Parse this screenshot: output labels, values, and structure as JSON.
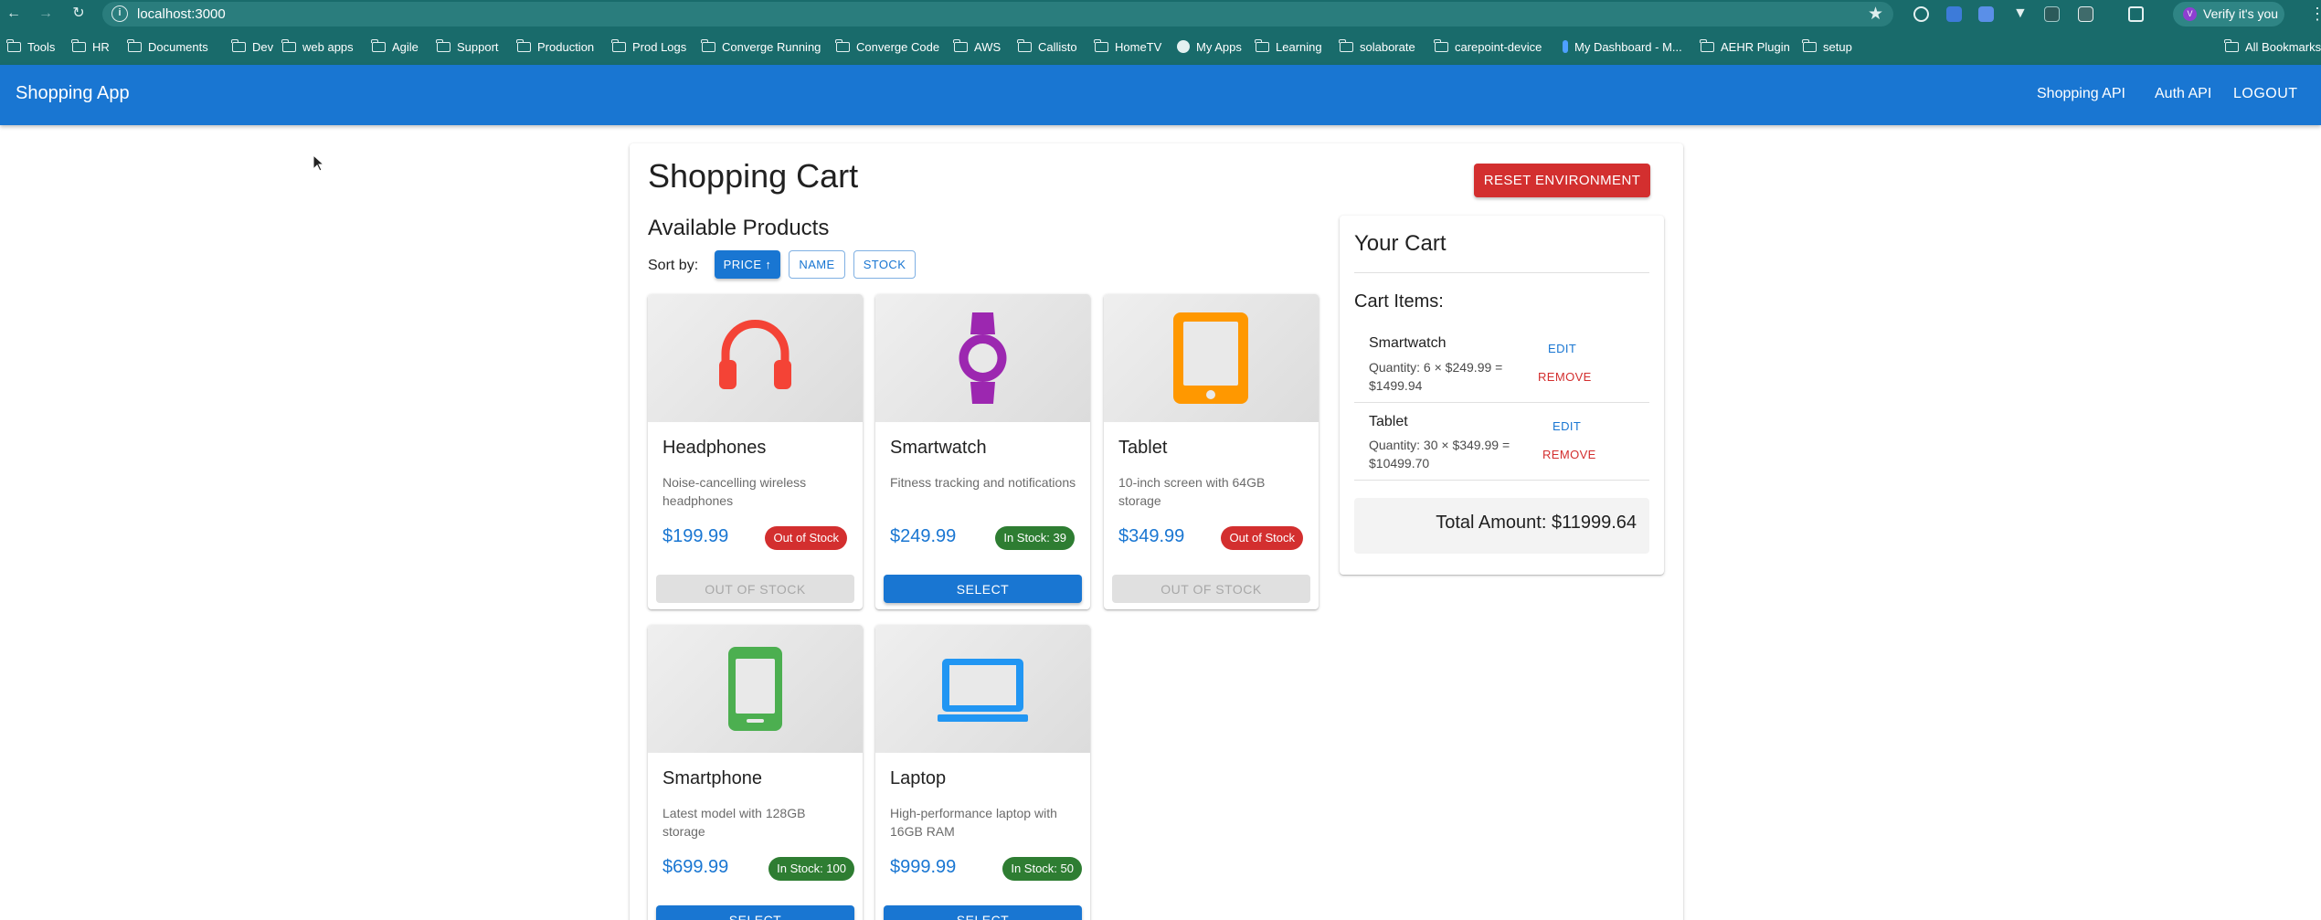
{
  "browser": {
    "url": "localhost:3000",
    "profile_label": "Verify it's you",
    "profile_initial": "V",
    "all_bookmarks_label": "All Bookmarks",
    "bookmarks": [
      {
        "label": "Tools",
        "icon": "folder-icon"
      },
      {
        "label": "HR",
        "icon": "folder-icon"
      },
      {
        "label": "Documents",
        "icon": "folder-icon"
      },
      {
        "label": "Dev",
        "icon": "folder-icon"
      },
      {
        "label": "web apps",
        "icon": "folder-icon"
      },
      {
        "label": "Agile",
        "icon": "folder-icon"
      },
      {
        "label": "Support",
        "icon": "folder-icon"
      },
      {
        "label": "Production",
        "icon": "folder-icon"
      },
      {
        "label": "Prod Logs",
        "icon": "folder-icon"
      },
      {
        "label": "Converge Running",
        "icon": "folder-icon"
      },
      {
        "label": "Converge Code",
        "icon": "folder-icon"
      },
      {
        "label": "AWS",
        "icon": "folder-icon"
      },
      {
        "label": "Callisto",
        "icon": "folder-icon"
      },
      {
        "label": "HomeTV",
        "icon": "folder-icon"
      },
      {
        "label": "My Apps",
        "icon": "globe-icon"
      },
      {
        "label": "Learning",
        "icon": "folder-icon"
      },
      {
        "label": "solaborate",
        "icon": "folder-icon"
      },
      {
        "label": "carepoint-device",
        "icon": "folder-icon"
      },
      {
        "label": "My Dashboard - M...",
        "icon": "bookmark-pin-icon"
      },
      {
        "label": "AEHR Plugin",
        "icon": "folder-icon"
      },
      {
        "label": "setup",
        "icon": "folder-icon"
      }
    ]
  },
  "app": {
    "brand": "Shopping App",
    "nav": [
      "Shopping API",
      "Auth API",
      "LOGOUT"
    ]
  },
  "page": {
    "title": "Shopping Cart",
    "reset_label": "RESET ENVIRONMENT",
    "products_heading": "Available Products",
    "sort_label": "Sort by:",
    "sort_options": [
      "PRICE ↑",
      "NAME",
      "STOCK"
    ],
    "sort_active": "PRICE ↑"
  },
  "products": [
    {
      "name": "Headphones",
      "description": "Noise-cancelling wireless headphones",
      "price": "$199.99",
      "stock_label": "Out of Stock",
      "button_label": "OUT OF STOCK",
      "in_stock": false,
      "icon": "headphones-icon",
      "icon_color": "#f44336"
    },
    {
      "name": "Smartwatch",
      "description": "Fitness tracking and notifications",
      "price": "$249.99",
      "stock_label": "In Stock: 39",
      "button_label": "SELECT",
      "in_stock": true,
      "icon": "watch-icon",
      "icon_color": "#9c27b0"
    },
    {
      "name": "Tablet",
      "description": "10-inch screen with 64GB storage",
      "price": "$349.99",
      "stock_label": "Out of Stock",
      "button_label": "OUT OF STOCK",
      "in_stock": false,
      "icon": "tablet-icon",
      "icon_color": "#ff9800"
    },
    {
      "name": "Smartphone",
      "description": "Latest model with 128GB storage",
      "price": "$699.99",
      "stock_label": "In Stock: 100",
      "button_label": "SELECT",
      "in_stock": true,
      "icon": "smartphone-icon",
      "icon_color": "#4caf50"
    },
    {
      "name": "Laptop",
      "description": "High-performance laptop with 16GB RAM",
      "price": "$999.99",
      "stock_label": "In Stock: 50",
      "button_label": "SELECT",
      "in_stock": true,
      "icon": "laptop-icon",
      "icon_color": "#2196f3"
    }
  ],
  "cart": {
    "title": "Your Cart",
    "items_heading": "Cart Items:",
    "items": [
      {
        "name": "Smartwatch",
        "line1": "Quantity: 6 × $249.99 =",
        "line2": "$1499.94",
        "edit_label": "EDIT",
        "remove_label": "REMOVE"
      },
      {
        "name": "Tablet",
        "line1": "Quantity: 30 × $349.99 =",
        "line2": "$10499.70",
        "edit_label": "EDIT",
        "remove_label": "REMOVE"
      }
    ],
    "total_text": "Total Amount: $11999.64"
  },
  "colors": {
    "primary": "#1976d2",
    "danger": "#d32f2f",
    "success": "#2e7d32",
    "chrome": "#196b6b"
  }
}
